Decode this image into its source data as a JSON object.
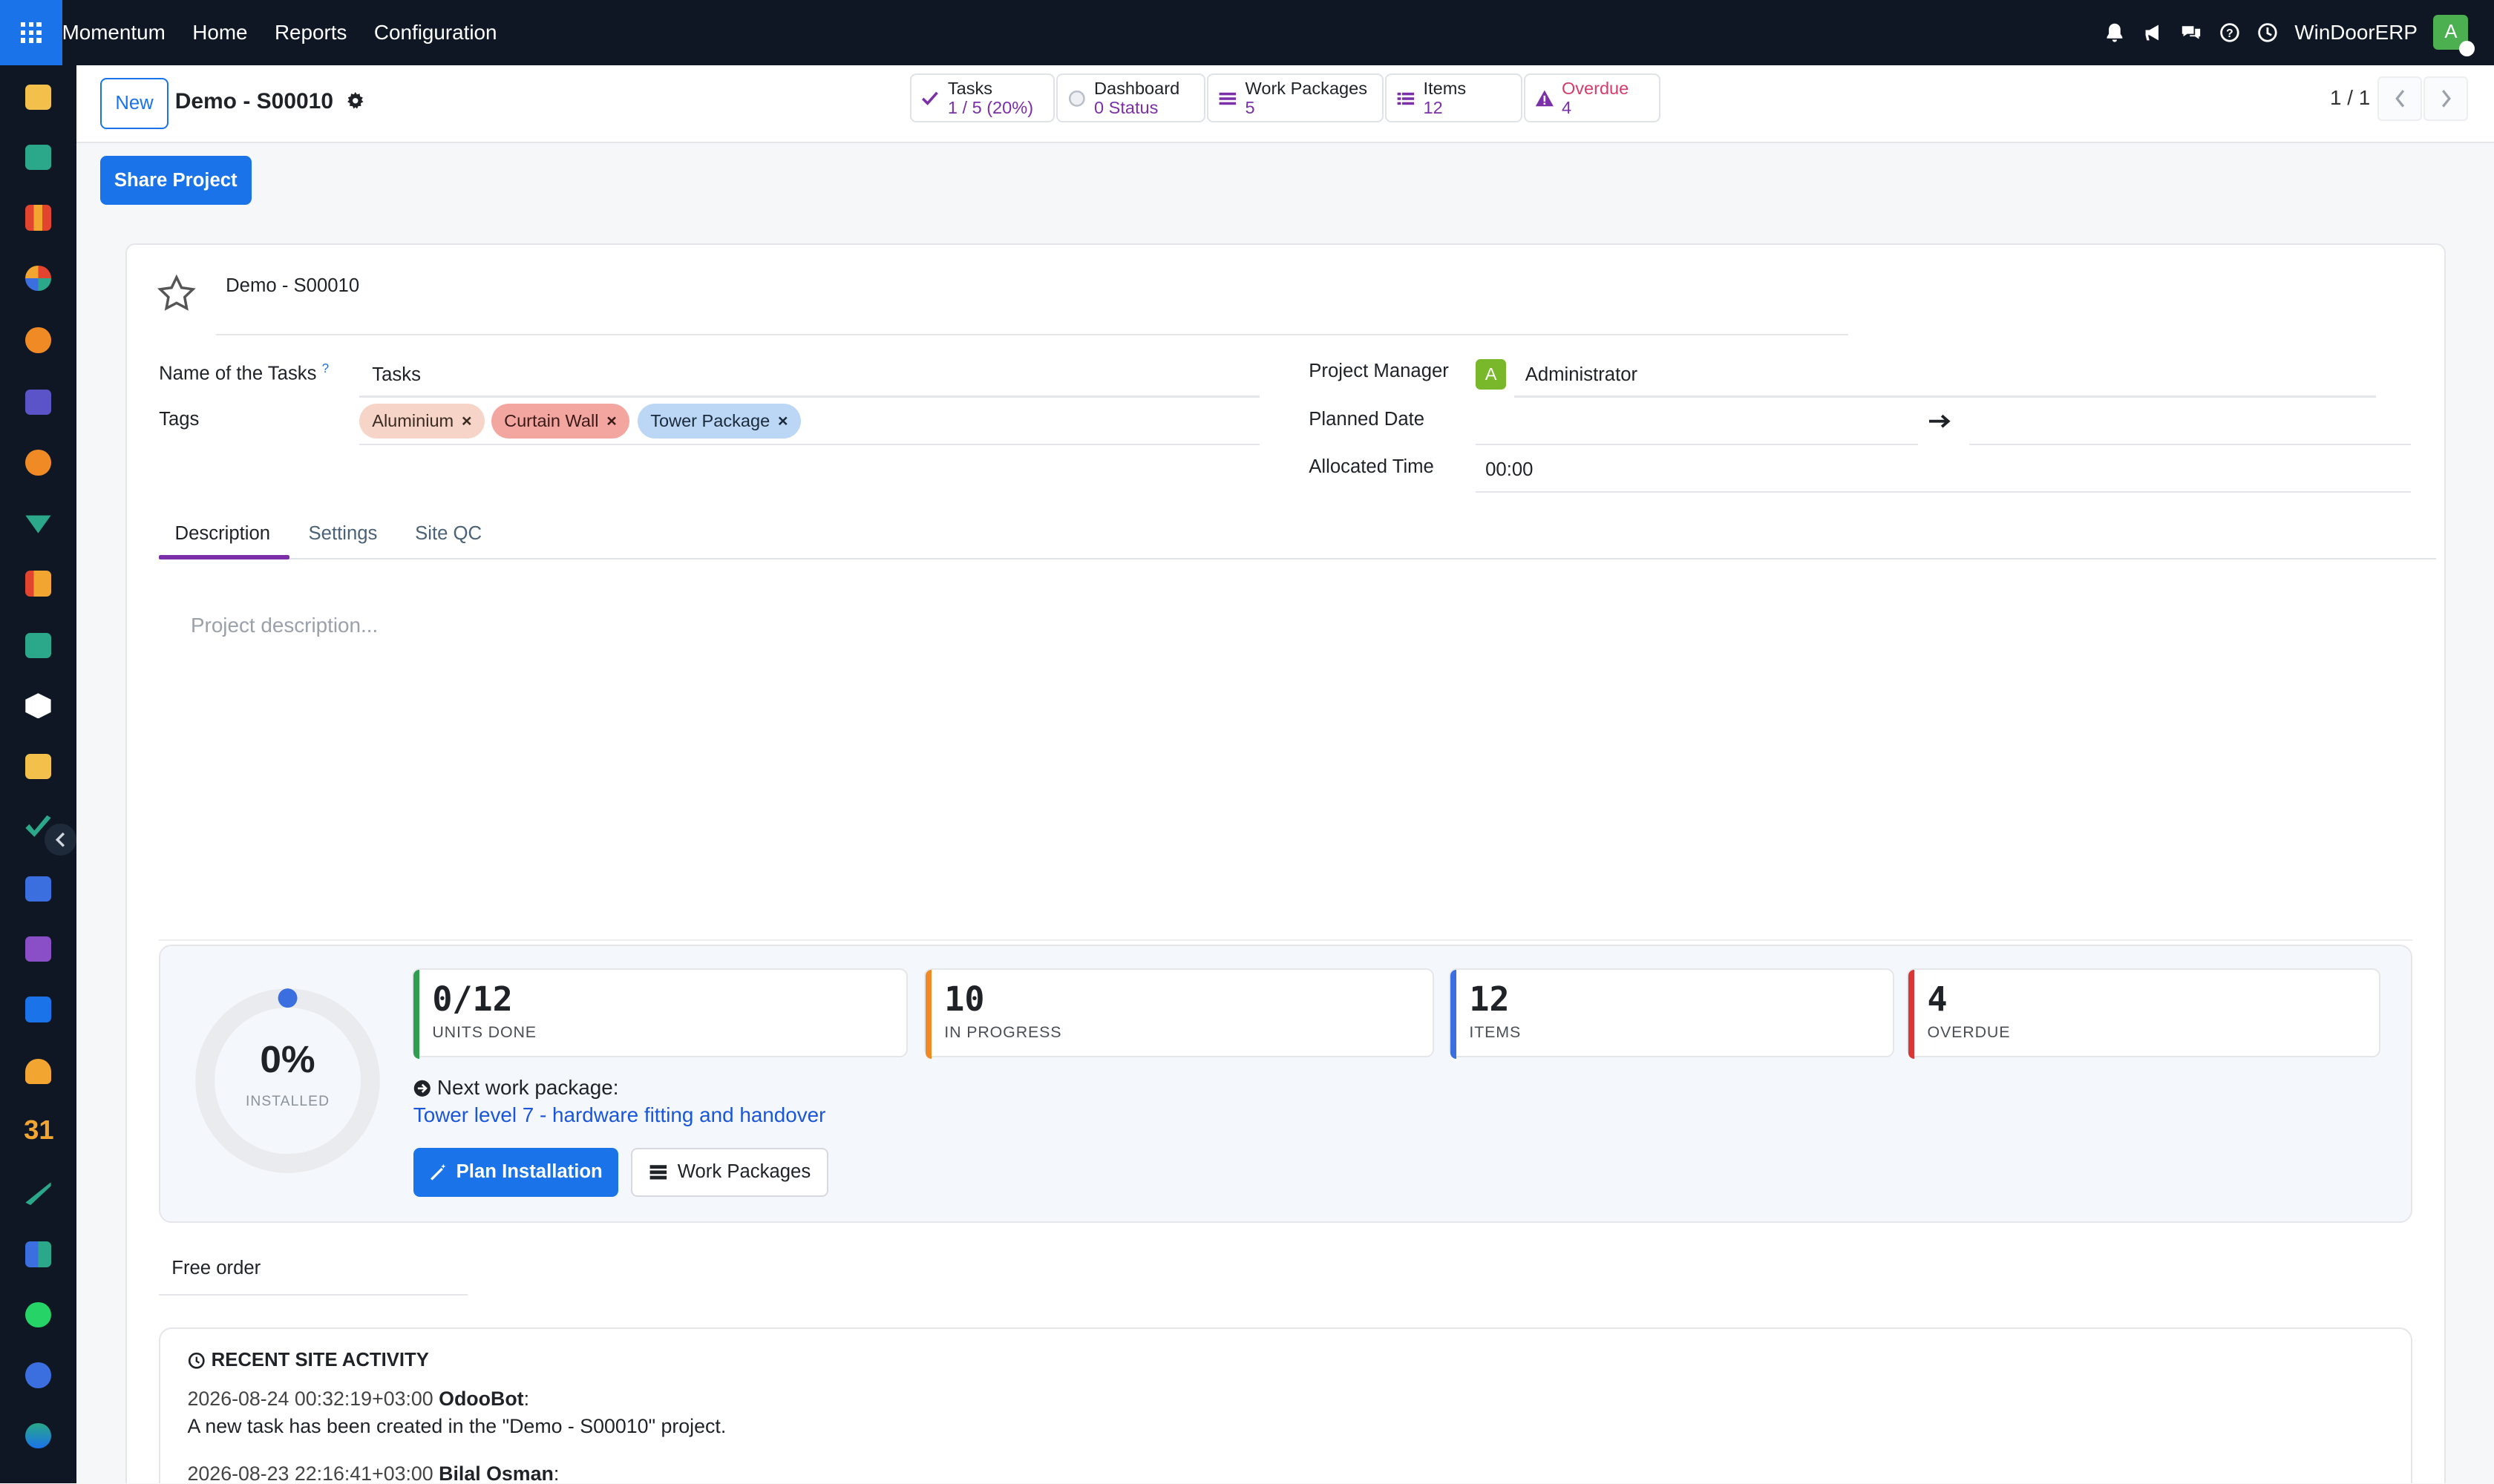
{
  "topbar": {
    "app_name": "Momentum",
    "menu": [
      "Home",
      "Reports",
      "Configuration"
    ],
    "company": "WinDoorERP",
    "user_initial": "A",
    "icons": [
      "bell-icon",
      "megaphone-icon",
      "chat-icon",
      "help-icon",
      "clock-icon"
    ]
  },
  "sidebar": {
    "app_icons": [
      "app-icon-1",
      "app-icon-2",
      "app-icon-3",
      "app-icon-4",
      "app-icon-5",
      "app-icon-6",
      "app-icon-7",
      "app-icon-8",
      "app-icon-9",
      "app-icon-10",
      "app-icon-11",
      "app-icon-12",
      "app-icon-13",
      "app-icon-14",
      "app-icon-15",
      "app-icon-16",
      "app-icon-17",
      "app-icon-18",
      "app-icon-19",
      "app-icon-20",
      "app-icon-21",
      "app-icon-22",
      "app-icon-23"
    ],
    "calendar_label": "31"
  },
  "control": {
    "new_label": "New",
    "record_title": "Demo - S00010",
    "pager": "1 / 1"
  },
  "smart_buttons": [
    {
      "label": "Tasks",
      "value": "1 / 5 (20%)"
    },
    {
      "label": "Dashboard",
      "value": "0 Status"
    },
    {
      "label": "Work Packages",
      "value": "5"
    },
    {
      "label": "Items",
      "value": "12"
    },
    {
      "label": "Overdue",
      "value": "4"
    }
  ],
  "share_label": "Share Project",
  "form": {
    "project_name": "Demo - S00010",
    "name_of_tasks_label": "Name of the Tasks",
    "name_of_tasks_help": "?",
    "name_of_tasks_value": "Tasks",
    "tags_label": "Tags",
    "tags": [
      {
        "name": "Aluminium",
        "color": "#f6d5c8"
      },
      {
        "name": "Curtain Wall",
        "color": "#f3a6a0"
      },
      {
        "name": "Tower Package",
        "color": "#bcd7f5"
      }
    ],
    "project_manager_label": "Project Manager",
    "project_manager_initial": "A",
    "project_manager_value": "Administrator",
    "planned_date_label": "Planned Date",
    "allocated_time_label": "Allocated Time",
    "allocated_time_value": "00:00"
  },
  "tabs": [
    "Description",
    "Settings",
    "Site QC"
  ],
  "description_placeholder": "Project description...",
  "dashboard": {
    "installed_pct": "0%",
    "installed_label": "INSTALLED",
    "installed_fraction": 0,
    "kpis": [
      {
        "value": "0/12",
        "label": "UNITS DONE",
        "color": "#2e9e4f"
      },
      {
        "value": "10",
        "label": "IN PROGRESS",
        "color": "#f08a24"
      },
      {
        "value": "12",
        "label": "ITEMS",
        "color": "#3b6fe0"
      },
      {
        "value": "4",
        "label": "OVERDUE",
        "color": "#d93636"
      }
    ],
    "next_label": "Next work package:",
    "next_link": "Tower level 7 - hardware fitting and handover",
    "plan_label": "Plan Installation",
    "work_packages_label": "Work Packages"
  },
  "free_order": "Free order",
  "activity": {
    "title": "RECENT SITE ACTIVITY",
    "entries": [
      {
        "timestamp": "2026-08-24 00:32:19+03:00",
        "author": "OdooBot",
        "message": "A new task has been created in the \"Demo - S00010\" project."
      },
      {
        "timestamp": "2026-08-23 22:16:41+03:00",
        "author": "Bilal Osman",
        "message": ""
      }
    ]
  },
  "colors": {
    "accent": "#1a73e8",
    "topbar": "#0f1724",
    "tab_active": "#7b2fa8",
    "overdue": "#d63b6a"
  }
}
